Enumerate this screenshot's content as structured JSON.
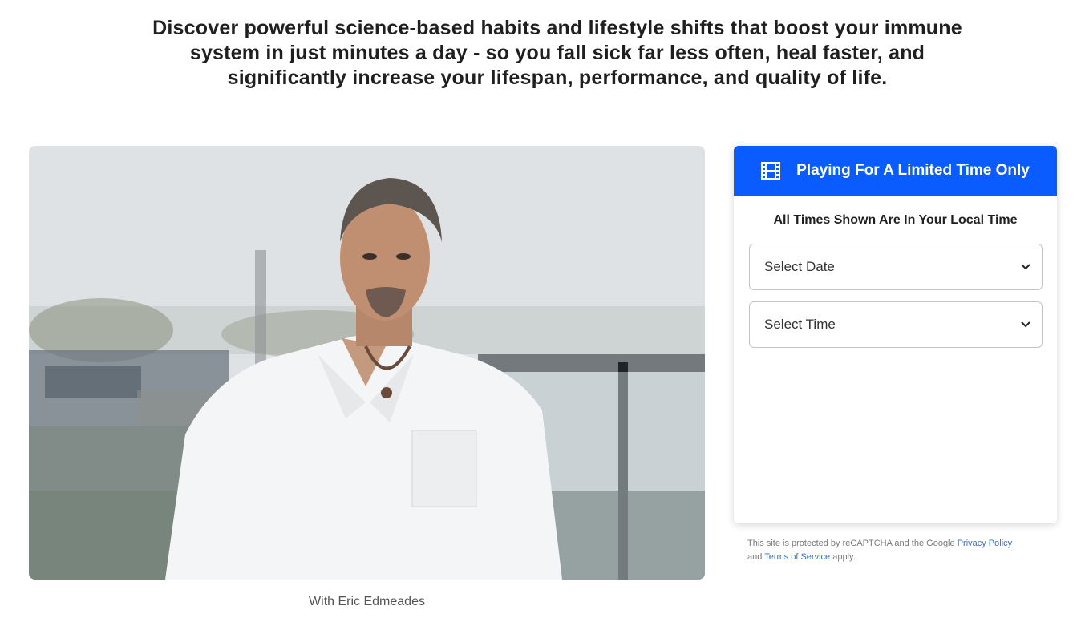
{
  "headline": {
    "line1": "Discover powerful science-based habits and lifestyle shifts that boost your immune",
    "line2": "system in just minutes a day - so you fall sick far less often, heal faster, and",
    "line3": "significantly increase your lifespan, performance, and quality of life."
  },
  "media": {
    "caption": "With Eric Edmeades"
  },
  "registration": {
    "header_icon": "film-icon",
    "header_title": "Playing For A Limited Time Only",
    "subtitle": "All Times Shown Are In Your Local Time",
    "date_select": "Select Date",
    "time_select": "Select Time",
    "accent_color": "#0a5cff"
  },
  "recaptcha": {
    "prefix": "This site is protected by reCAPTCHA and the Google",
    "privacy_link": "Privacy Policy",
    "middle": "and",
    "terms_link": "Terms of Service",
    "suffix": "apply."
  }
}
